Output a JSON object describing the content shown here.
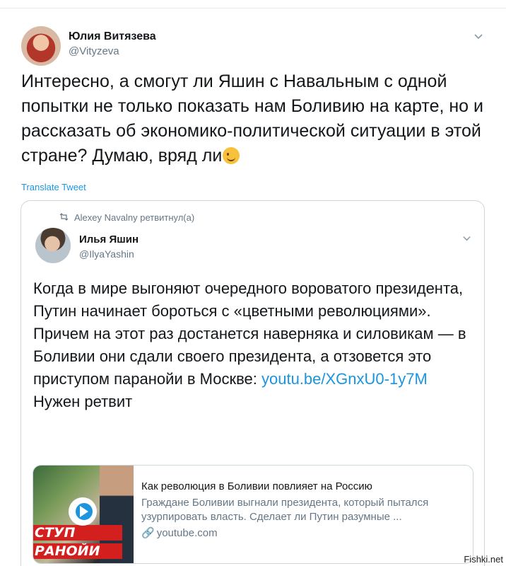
{
  "tweet": {
    "author_name": "Юлия Витязева",
    "author_handle": "@Vityzeva",
    "text": "Интересно, а смогут ли Яшин с Навальным с одной попытки не только показать нам Боливию на карте, но и рассказать об экономико-политической ситуации в этой стране? Думаю, вряд ли",
    "emoji": "winking-face",
    "translate_label": "Translate Tweet"
  },
  "quoted": {
    "retweet_line": "Alexey Navalny ретвитнул(а)",
    "author_name": "Илья Яшин",
    "author_handle": "@IlyaYashin",
    "text_before_link": "Когда в мире выгоняют очередного вороватого президента, Путин начинает бороться с «цветными революциями». Причем на этот раз достанется наверняка и силовикам — в Боливии они сдали своего президента, а отзовется это приступом паранойи в Москве: ",
    "link": "youtu.be/XGnxU0-1y7M",
    "text_after_link": "Нужен ретвит",
    "card": {
      "title": "Как революция в Боливии повлияет на Россию",
      "description": "Граждане Боливии выгнали президента, который пытался узурпировать власть. Сделает ли Путин разумные ...",
      "domain": "youtube.com",
      "thumb_caption_1": "СТУП",
      "thumb_caption_2": "РАНОЙИ"
    }
  },
  "watermark": "Fishki.net",
  "colors": {
    "link": "#1b95e0",
    "secondary_text": "#657786",
    "border": "#ccd6dd"
  },
  "icons": [
    "chevron-down-icon",
    "retweet-icon",
    "play-icon",
    "link-icon"
  ]
}
